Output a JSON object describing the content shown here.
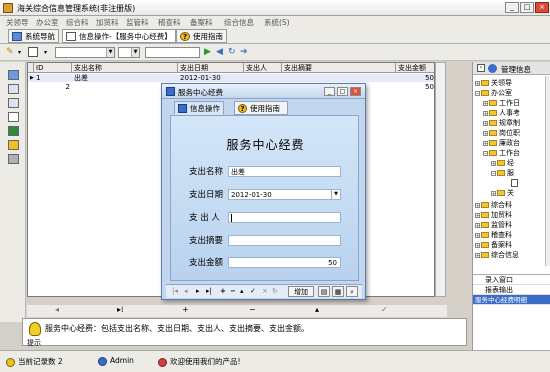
{
  "window": {
    "title": "海关综合信息管理系统(非注册版)"
  },
  "menu": [
    "关领导",
    "办公室",
    "综合科",
    "加贸科",
    "监管科",
    "稽查科",
    "备案科",
    "综合信息",
    "系统(S)"
  ],
  "tabs": [
    {
      "label": "系统导航"
    },
    {
      "label": "信息操作-【服务中心经费】"
    },
    {
      "label": "使用指南"
    }
  ],
  "grid": {
    "columns": [
      "ID",
      "支出名称",
      "支出日期",
      "支出人",
      "支出摘要",
      "支出金额"
    ],
    "rows": [
      {
        "id": "1",
        "name": "出差",
        "date": "2012-01-30",
        "person": "",
        "summary": "",
        "amount": "50"
      },
      {
        "id": "2",
        "name": "",
        "date": "",
        "person": "",
        "summary": "",
        "amount": "50"
      }
    ]
  },
  "hint": {
    "text": "服务中心经费：包括支出名称、支出日期、支出人、支出摘要、支出金额。",
    "label": "提示"
  },
  "status": {
    "count_label": "当前记录数",
    "count": "2",
    "user": "Admin",
    "welcome": "欢迎使用我们的产品!"
  },
  "right_panel": {
    "title": "管理信息",
    "tree": [
      {
        "label": "关领导"
      },
      {
        "label": "办公室"
      },
      {
        "label": "工作日"
      },
      {
        "label": "人事考"
      },
      {
        "label": "规章制"
      },
      {
        "label": "岗位职"
      },
      {
        "label": "廉政台"
      },
      {
        "label": "工作台"
      },
      {
        "label": "经"
      },
      {
        "label": "服"
      },
      {
        "label": "关"
      },
      {
        "label": "综合科"
      },
      {
        "label": "加贸科"
      },
      {
        "label": "监管科"
      },
      {
        "label": "稽查科"
      },
      {
        "label": "备案科"
      },
      {
        "label": "综合信息"
      }
    ],
    "list": [
      "录入窗口",
      "报表输出",
      "服务中心经费明细"
    ]
  },
  "dialog": {
    "title": "服务中心经费",
    "tabs": [
      "信息操作",
      "使用指南"
    ],
    "form_title": "服务中心经费",
    "fields": [
      {
        "label": "支出名称",
        "value": "出差"
      },
      {
        "label": "支出日期",
        "value": "2012-01-30"
      },
      {
        "label": "支 出 人",
        "value": ""
      },
      {
        "label": "支出摘要",
        "value": ""
      },
      {
        "label": "支出金额",
        "value": "50"
      }
    ],
    "add_label": "增加"
  }
}
